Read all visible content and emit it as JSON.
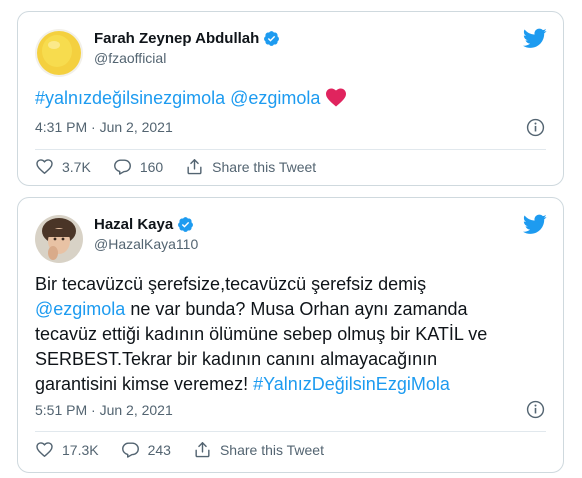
{
  "tweets": [
    {
      "name": "Farah Zeynep Abdullah",
      "handle": "@fzaofficial",
      "text_link": "#yalnızdeğilsinezgimola @ezgimola",
      "emoji": "❤",
      "time": "4:31 PM · Jun 2, 2021",
      "likes": "3.7K",
      "replies": "160",
      "share": "Share this Tweet"
    },
    {
      "name": "Hazal Kaya",
      "handle": "@HazalKaya110",
      "lines": [
        {
          "pre": "Bir tecavüzcü şerefsize,tecavüzcü şerefsiz demiş",
          "link": "",
          "post": ""
        },
        {
          "pre": "",
          "link": "@ezgimola",
          "post": " ne var bunda? Musa Orhan aynı zamanda"
        },
        {
          "pre": "tecavüz ettiği kadının ölümüne sebep olmuş bir KATİL ve",
          "link": "",
          "post": ""
        },
        {
          "pre": "SERBEST.Tekrar bir kadının canını almayacağının",
          "link": "",
          "post": ""
        },
        {
          "pre": "garantisini kimse veremez! ",
          "link": "#YalnızDeğilsinEzgiMola",
          "post": ""
        }
      ],
      "time": "5:51 PM · Jun 2, 2021",
      "likes": "17.3K",
      "replies": "243",
      "share": "Share this Tweet"
    }
  ],
  "colors": {
    "accent": "#1d9bf0",
    "heart": "#e0245e",
    "muted": "#536471"
  }
}
